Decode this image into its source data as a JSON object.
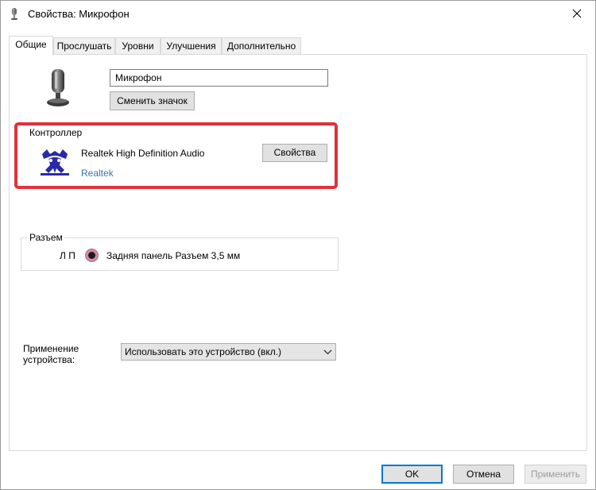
{
  "window": {
    "title": "Свойства: Микрофон",
    "close_glyph": "✕"
  },
  "tabs": [
    {
      "label": "Общие",
      "active": true
    },
    {
      "label": "Прослушать",
      "active": false
    },
    {
      "label": "Уровни",
      "active": false
    },
    {
      "label": "Улучшения",
      "active": false
    },
    {
      "label": "Дополнительно",
      "active": false
    }
  ],
  "general": {
    "device_name_value": "Микрофон",
    "change_icon_label": "Сменить значок"
  },
  "controller": {
    "group_label": "Контроллер",
    "name": "Realtek High Definition Audio",
    "vendor_link": "Realtek",
    "properties_label": "Свойства",
    "highlight_color": "#e0323d"
  },
  "jack": {
    "group_label": "Разъем",
    "channels": "Л П",
    "description": "Задняя панель Разъем 3,5 мм",
    "jack_color": "#d08aa8"
  },
  "usage": {
    "label": "Применение устройства:",
    "selected": "Использовать это устройство (вкл.)"
  },
  "footer": {
    "ok_label": "OK",
    "cancel_label": "Отмена",
    "apply_label": "Применить"
  },
  "icons": {
    "title": "microphone-small-icon",
    "device": "microphone-icon",
    "vendor": "realtek-logo-icon",
    "close": "close-icon",
    "dropdown": "chevron-down-icon"
  }
}
